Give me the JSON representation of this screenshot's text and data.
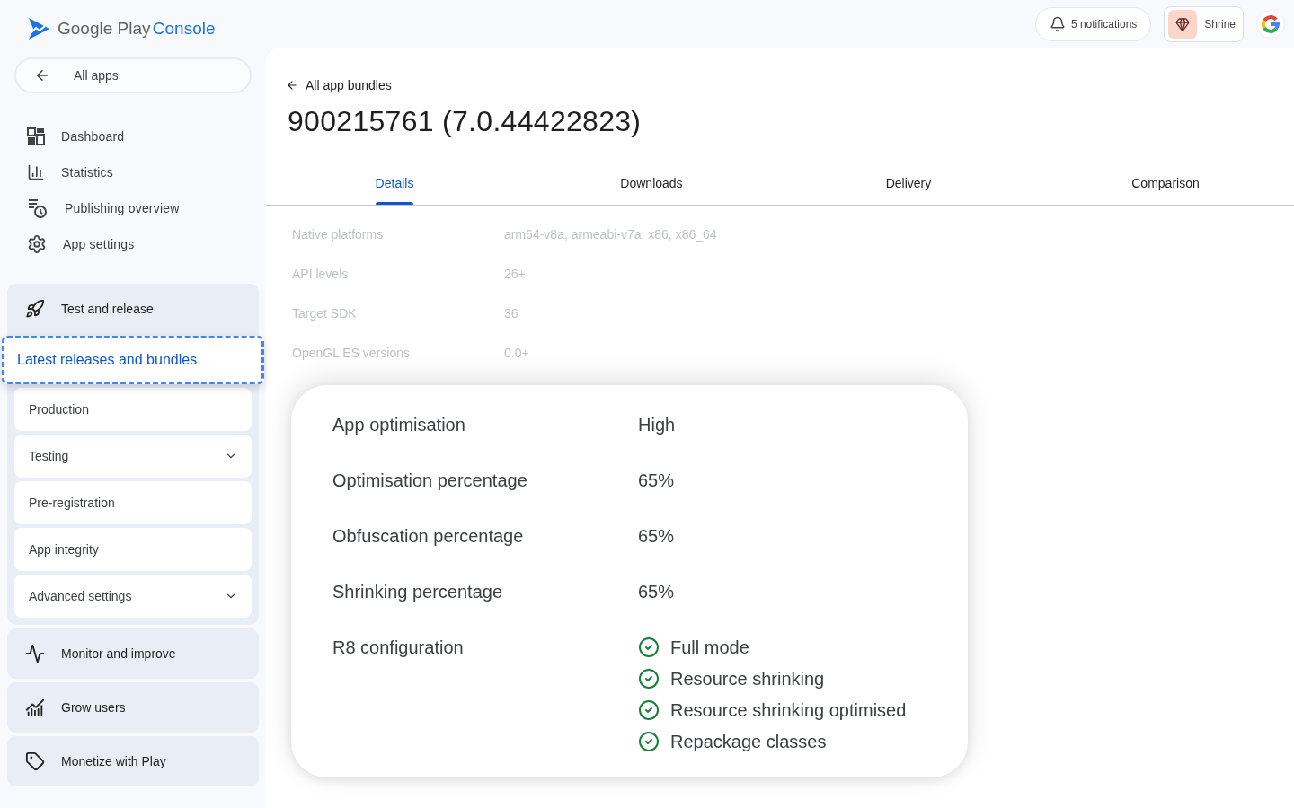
{
  "brand": {
    "name": "Google Play",
    "product": "Console"
  },
  "header": {
    "notifications": "5 notifications",
    "app": "Shrine"
  },
  "sidebar": {
    "back": "All apps",
    "items": [
      {
        "label": "Dashboard"
      },
      {
        "label": "Statistics"
      },
      {
        "label": "Publishing overview"
      },
      {
        "label": "App settings"
      }
    ],
    "groups": [
      {
        "label": "Test and release",
        "expanded": true,
        "children": [
          {
            "label": "Latest releases and bundles",
            "selected": true
          },
          {
            "label": "Production",
            "selected": false
          },
          {
            "label": "Testing",
            "selected": false,
            "expanded": false
          },
          {
            "label": "Pre-registration",
            "selected": false
          },
          {
            "label": "App integrity",
            "selected": false
          },
          {
            "label": "Advanced settings",
            "selected": false,
            "expanded": false
          }
        ]
      },
      {
        "label": "Monitor and improve",
        "expanded": false
      },
      {
        "label": "Grow users",
        "expanded": false
      },
      {
        "label": "Monetize with Play",
        "expanded": false
      }
    ]
  },
  "main": {
    "back": "All app bundles",
    "title": "900215761 (7.0.44422823)",
    "tabs": [
      {
        "label": "Details",
        "selected": true
      },
      {
        "label": "Downloads",
        "selected": false
      },
      {
        "label": "Delivery",
        "selected": false
      },
      {
        "label": "Comparison",
        "selected": false
      }
    ],
    "details": [
      {
        "label": "Native platforms",
        "value": "arm64-v8a, armeabi-v7a, x86, x86_64"
      },
      {
        "label": "API levels",
        "value": "26+"
      },
      {
        "label": "Target SDK",
        "value": "36"
      },
      {
        "label": "OpenGL ES versions",
        "value": "0.0+"
      }
    ],
    "card": [
      {
        "kind": "text",
        "label": "App optimisation",
        "value": "High"
      },
      {
        "kind": "text",
        "label": "Optimisation percentage",
        "value": "65%"
      },
      {
        "kind": "text",
        "label": "Obfuscation percentage",
        "value": "65%"
      },
      {
        "kind": "text",
        "label": "Shrinking percentage",
        "value": "65%"
      },
      {
        "kind": "checklist",
        "label": "R8 configuration",
        "items": [
          {
            "label": "Full mode",
            "checked": true
          },
          {
            "label": "Resource shrinking",
            "checked": true
          },
          {
            "label": "Resource shrinking optimised",
            "checked": true
          },
          {
            "label": "Repackage classes",
            "checked": true
          }
        ]
      }
    ]
  }
}
